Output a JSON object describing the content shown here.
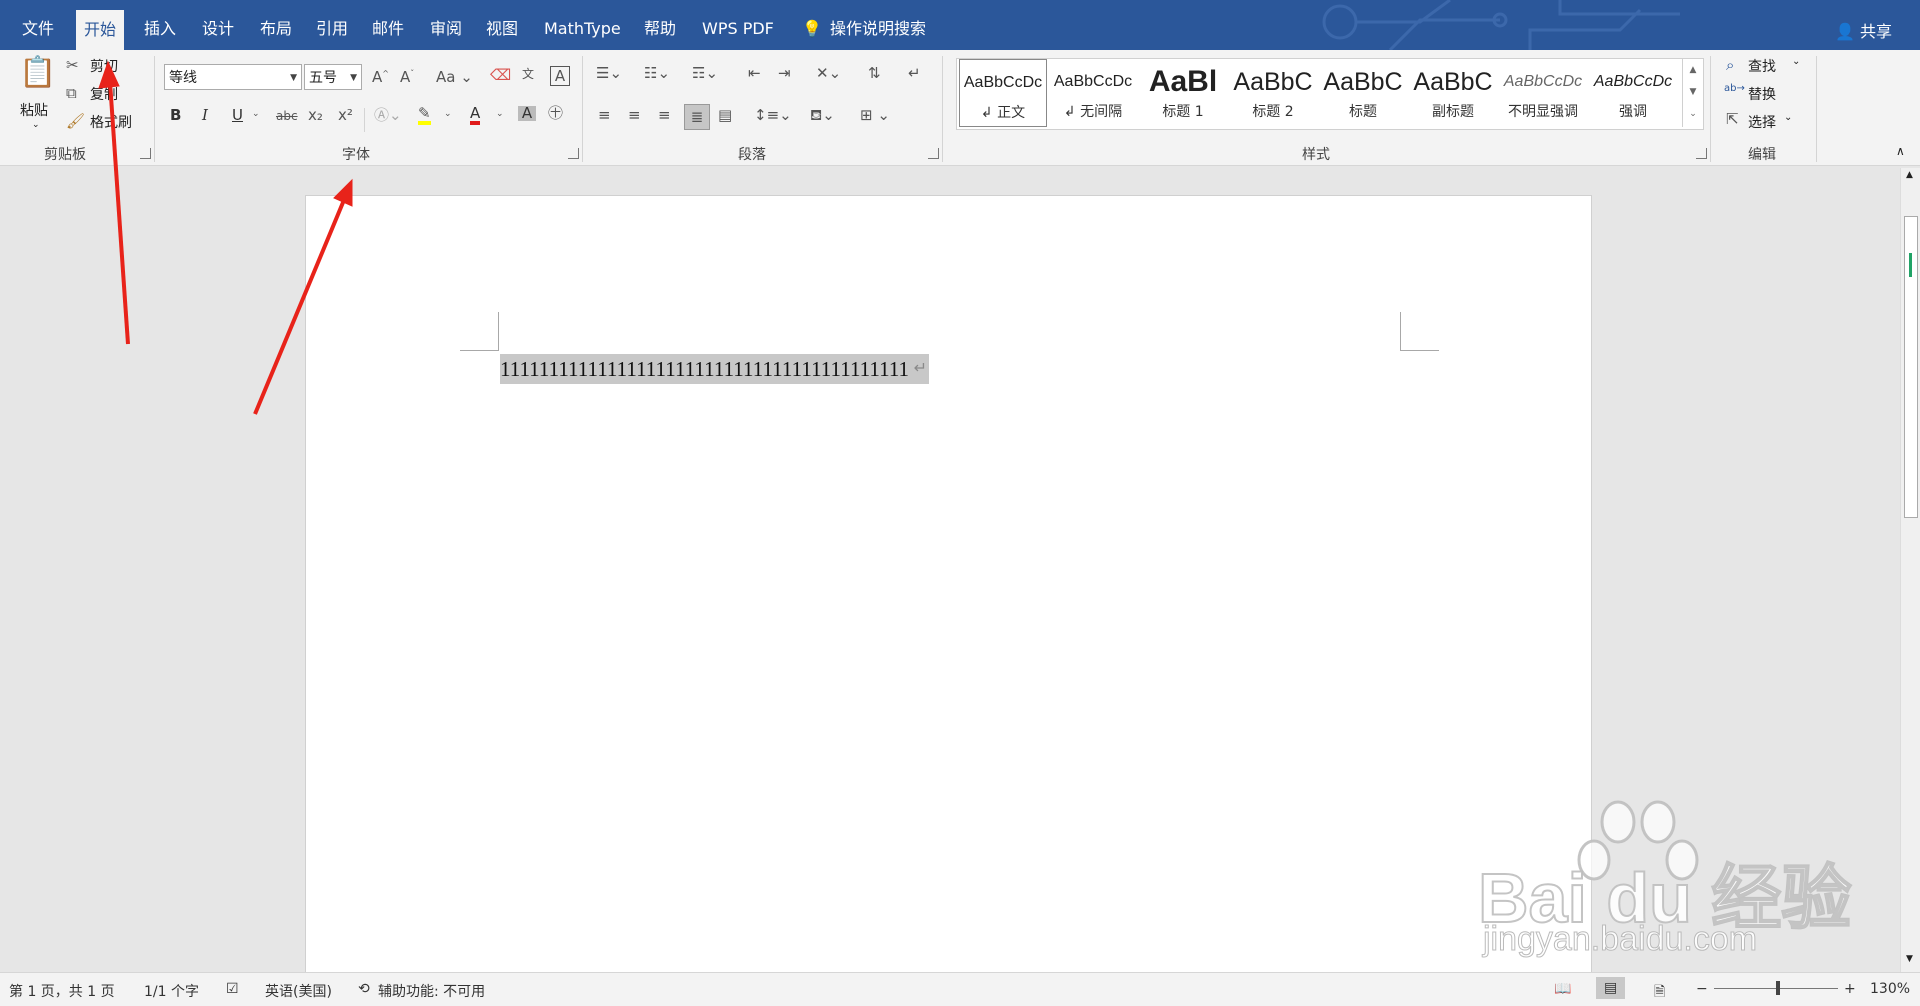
{
  "tabs": [
    "文件",
    "开始",
    "插入",
    "设计",
    "布局",
    "引用",
    "邮件",
    "审阅",
    "视图",
    "MathType",
    "帮助",
    "WPS PDF"
  ],
  "tell_me": "操作说明搜索",
  "share": "共享",
  "clipboard": {
    "paste": "粘贴",
    "cut": "剪切",
    "copy": "复制",
    "format_painter": "格式刷",
    "label": "剪贴板"
  },
  "font": {
    "name": "等线",
    "size": "五号",
    "label": "字体",
    "aa": "Aa",
    "bold": "B",
    "italic": "I",
    "underline": "U",
    "strike": "abc",
    "sub": "x₂",
    "sup": "x²",
    "font_color": "A",
    "shade": "A"
  },
  "paragraph": {
    "label": "段落"
  },
  "styles": {
    "label": "样式",
    "items": [
      {
        "preview": "AaBbCcDc",
        "name": "↲ 正文"
      },
      {
        "preview": "AaBbCcDc",
        "name": "↲ 无间隔"
      },
      {
        "preview": "AaBl",
        "name": "标题 1"
      },
      {
        "preview": "AaBbC",
        "name": "标题 2"
      },
      {
        "preview": "AaBbC",
        "name": "标题"
      },
      {
        "preview": "AaBbC",
        "name": "副标题"
      },
      {
        "preview": "AaBbCcDc",
        "name": "不明显强调"
      },
      {
        "preview": "AaBbCcDc",
        "name": "强调"
      }
    ]
  },
  "editing": {
    "find": "查找",
    "replace": "替换",
    "select": "选择",
    "label": "编辑"
  },
  "document": {
    "text": "111111111111111111111111111111111111111111"
  },
  "status": {
    "page": "第 1 页，共 1 页",
    "words": "1/1 个字",
    "language": "英语(美国)",
    "accessibility": "辅助功能: 不可用",
    "zoom": "130%"
  },
  "watermark": {
    "brand": "Bai du 经验",
    "url": "jingyan.baidu.com"
  },
  "colors": {
    "ribbon_blue": "#2b579a",
    "arrow_red": "#e8231a",
    "selection": "#c8c8c8"
  }
}
